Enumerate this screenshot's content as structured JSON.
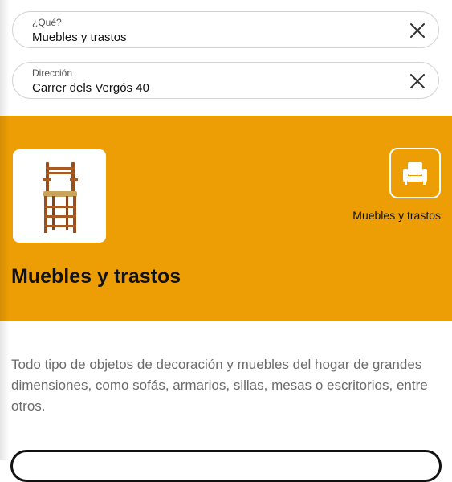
{
  "search": {
    "what": {
      "label": "¿Qué?",
      "value": "Muebles y trastos"
    },
    "address": {
      "label": "Dirección",
      "value": "Carrer dels Vergós 40"
    }
  },
  "category": {
    "title": "Muebles y trastos",
    "icon_caption": "Muebles y trastos",
    "icon": "armchair-icon",
    "image": "wooden-high-chair",
    "band_color": "#ED9E04"
  },
  "description": "Todo tipo de objetos de decoración y muebles del hogar de grandes dimensiones, como sofás, armarios, sillas, mesas o escritorios, entre otros."
}
